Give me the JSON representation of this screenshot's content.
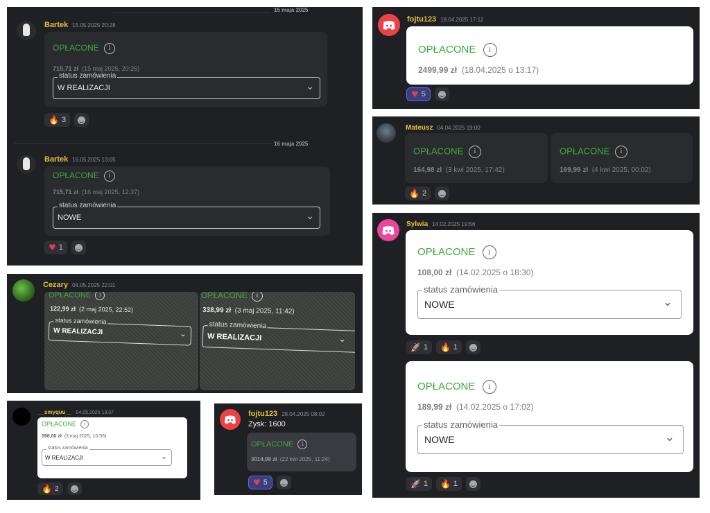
{
  "panel_a": {
    "date1": "15 maja 2025",
    "msg1": {
      "user": "Bartek",
      "time": "15.05.2025 20:28",
      "paid": "OPŁACONE",
      "amount": "715,71 zł",
      "paid_date": "(15 maj 2025, 20:26)",
      "legend": "status zamówienia",
      "status": "W REALIZACJI"
    },
    "reactions1": [
      {
        "icon": "fire-icon",
        "count": "3"
      }
    ],
    "date2": "16 maja 2025",
    "msg2": {
      "user": "Bartek",
      "time": "16.05.2025 13:05",
      "paid": "OPŁACONE",
      "amount": "715,71 zł",
      "paid_date": "(16 maj 2025, 12:37)",
      "legend": "status zamówienia",
      "status": "NOWE"
    },
    "reactions2": [
      {
        "icon": "heart-icon",
        "count": "1"
      }
    ]
  },
  "panel_b": {
    "user": "Cezary",
    "time": "04.05.2025 22:01",
    "left": {
      "paid": "OPŁACONE",
      "amount": "122,99 zł",
      "paid_date": "(2 maj 2025, 22:52)",
      "legend": "status zamówienia",
      "status": "W REALIZACJI"
    },
    "right": {
      "paid": "OPŁACONE",
      "amount": "338,99 zł",
      "paid_date": "(3 maj 2025, 11:42)",
      "legend": "status zamówienia",
      "status": "W REALIZACJI"
    }
  },
  "panel_c": {
    "user": "__smyquu__",
    "time": "04.05.2025 13:37",
    "paid": "OPŁACONE",
    "amount": "598,00 zł",
    "paid_date": "(3 maj 2025, 10:55)",
    "legend": "status zamówienia",
    "status": "W REALIZACJI",
    "reactions": [
      {
        "icon": "fire-icon",
        "count": "2"
      }
    ]
  },
  "panel_d": {
    "user": "fojtu123",
    "time": "28.04.2025 08:02",
    "text": "Zysk: 1600",
    "paid": "OPŁACONE",
    "amount": "3014,98 zł",
    "paid_date": "(22 kwi 2025, 11:24)",
    "reactions": [
      {
        "icon": "heart-icon",
        "count": "5"
      }
    ]
  },
  "panel_e": {
    "user": "fojtu123",
    "time": "18.04.2025 17:12",
    "paid": "OPŁACONE",
    "amount": "2499,99 zł",
    "paid_date": "(18.04.2025 o 13:17)",
    "reactions": [
      {
        "icon": "heart-icon",
        "count": "5"
      }
    ]
  },
  "panel_f": {
    "user": "Mateusz",
    "time": "04.04.2025 19:00",
    "left": {
      "paid": "OPŁACONE",
      "amount": "164,98 zł",
      "paid_date": "(3 kwi 2025, 17:42)"
    },
    "right": {
      "paid": "OPŁACONE",
      "amount": "169,99 zł",
      "paid_date": "(4 kwi 2025, 00:02)"
    },
    "reactions": [
      {
        "icon": "fire-icon",
        "count": "2"
      }
    ]
  },
  "panel_g": {
    "user": "Sylwia",
    "time": "14.02.2025 19:56",
    "card1": {
      "paid": "OPŁACONE",
      "amount": "108,00 zł",
      "paid_date": "(14.02.2025 o 18:30)",
      "legend": "status zamówienia",
      "status": "NOWE"
    },
    "reactions1": [
      {
        "icon": "rocket-icon",
        "count": "1"
      },
      {
        "icon": "fire-icon",
        "count": "1"
      }
    ],
    "card2": {
      "paid": "OPŁACONE",
      "amount": "189,99 zł",
      "paid_date": "(14.02.2025 o 17:02)",
      "legend": "status zamówienia",
      "status": "NOWE"
    },
    "reactions2": [
      {
        "icon": "rocket-icon",
        "count": "1"
      },
      {
        "icon": "fire-icon",
        "count": "1"
      }
    ]
  },
  "colors": {
    "panel_bg": "#1f2024",
    "username": "#e3c03d",
    "paid_green": "#3ea83a",
    "discord_red": "#ed4245",
    "discord_pink": "#eb459e"
  }
}
